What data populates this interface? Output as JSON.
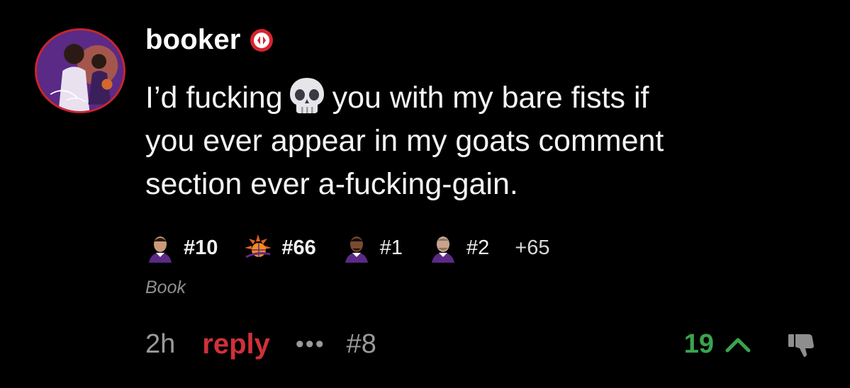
{
  "comment": {
    "username": "booker",
    "text_lines": [
      {
        "before_emoji": "I’d fucking",
        "after_emoji": "you with my bare fists if"
      },
      "you ever appear in my goats comment",
      "section ever a-fucking-gain."
    ],
    "emoji": "skull-icon",
    "tags": [
      {
        "icon": "player-face-icon",
        "label": "#10"
      },
      {
        "icon": "suns-logo-icon",
        "label": "#66"
      },
      {
        "icon": "player-face-icon",
        "label": "#1"
      },
      {
        "icon": "player-face-icon",
        "label": "#2"
      },
      {
        "label": "+65"
      }
    ],
    "flair": "Book",
    "time": "2h",
    "reply_label": "reply",
    "more_label": "•••",
    "comment_number": "#8",
    "vote_count": "19"
  },
  "colors": {
    "background": "#000000",
    "reply": "#d0313a",
    "vote_count": "#3aa34e",
    "avatar_ring": "#c8262f",
    "muted": "#9a9a9a"
  }
}
